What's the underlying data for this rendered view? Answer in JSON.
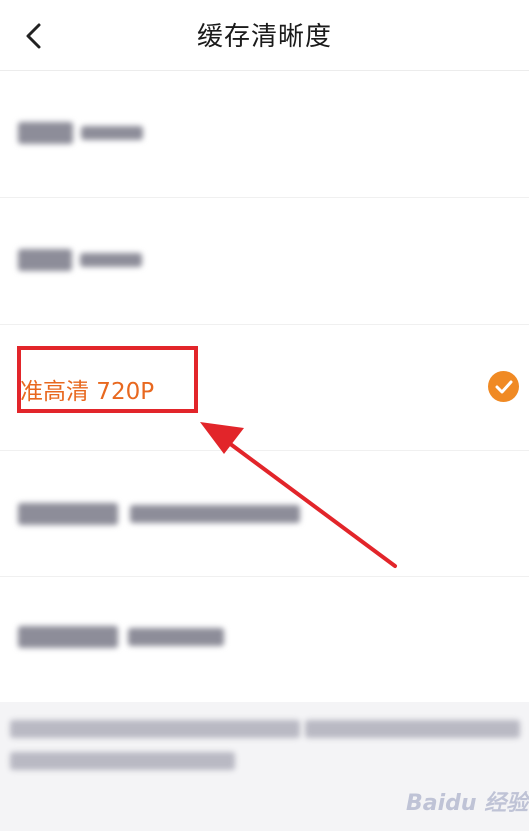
{
  "header": {
    "title": "缓存清晰度"
  },
  "options": [
    {
      "label": "",
      "selected": false
    },
    {
      "label": "",
      "selected": false
    },
    {
      "label": "准高清 720P",
      "selected": true
    },
    {
      "label": "",
      "selected": false
    },
    {
      "label": "",
      "selected": false
    }
  ],
  "footer_note": "",
  "watermark": "Baidu 经验",
  "colors": {
    "accent": "#f08a24",
    "annotation": "#e2252a",
    "selected_text": "#e8681f"
  },
  "icons": {
    "back": "chevron-left-icon",
    "selected": "check-circle-icon"
  }
}
